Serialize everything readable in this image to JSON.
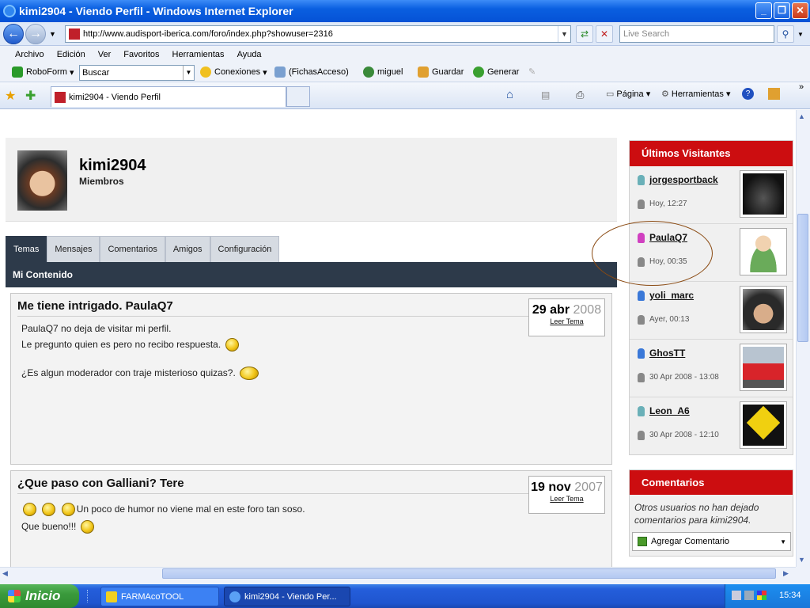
{
  "window": {
    "title": "kimi2904 - Viendo Perfil - Windows Internet Explorer"
  },
  "address": {
    "url": "http://www.audisport-iberica.com/foro/index.php?showuser=2316",
    "search_placeholder": "Live Search"
  },
  "menu": [
    "Archivo",
    "Edición",
    "Ver",
    "Favoritos",
    "Herramientas",
    "Ayuda"
  ],
  "toolbar": {
    "roboform": "RoboForm",
    "buscar": "Buscar",
    "conexiones": "Conexiones",
    "fichas": "(FichasAcceso)",
    "miguel": "miguel",
    "guardar": "Guardar",
    "generar": "Generar"
  },
  "tab": {
    "title": "kimi2904 - Viendo Perfil"
  },
  "cmdbar": {
    "pagina": "Página",
    "herramientas": "Herramientas"
  },
  "profile": {
    "username": "kimi2904",
    "role": "Miembros"
  },
  "profile_tabs": [
    "Temas",
    "Mensajes",
    "Comentarios",
    "Amigos",
    "Configuración"
  ],
  "section_title": "Mi Contenido",
  "posts": [
    {
      "title": "Me tiene intrigado. PaulaQ7",
      "day": "29 abr",
      "year": "2008",
      "leer": "Leer Tema",
      "lines": [
        "PaulaQ7 no deja de visitar mi perfil.",
        "Le pregunto quien es pero no recibo respuesta.",
        "¿Es algun moderador con traje misterioso quizas?."
      ]
    },
    {
      "title": "¿Que paso con Galliani? Tere",
      "day": "19 nov",
      "year": "2007",
      "leer": "Leer Tema",
      "lines": [
        "Un poco de humor no viene mal en este foro tan soso.",
        "Que bueno!!!"
      ]
    }
  ],
  "visitors": {
    "title": "Últimos Visitantes",
    "items": [
      {
        "name": "jorgesportback",
        "time": "Hoy, 12:27",
        "person_color": "#6ab0b8",
        "thumb": "car-dark"
      },
      {
        "name": "PaulaQ7",
        "time": "Hoy, 00:35",
        "person_color": "#d040c0",
        "thumb": "default-avatar"
      },
      {
        "name": "yoli_marc",
        "time": "Ayer, 00:13",
        "person_color": "#3a78d8",
        "thumb": "driver-photo"
      },
      {
        "name": "GhosTT",
        "time": "30 Apr 2008 - 13:08",
        "person_color": "#3a78d8",
        "thumb": "red-car"
      },
      {
        "name": "Leon_A6",
        "time": "30 Apr 2008 - 12:10",
        "person_color": "#6ab0b8",
        "thumb": "sign-yellow"
      }
    ]
  },
  "comments": {
    "title": "Comentarios",
    "text": "Otros usuarios no han dejado comentarios para kimi2904.",
    "add": "Agregar Comentario"
  },
  "taskbar": {
    "start": "Inicio",
    "tasks": [
      "FARMAcoTOOL",
      "kimi2904 - Viendo Per..."
    ],
    "clock": "15:34"
  }
}
